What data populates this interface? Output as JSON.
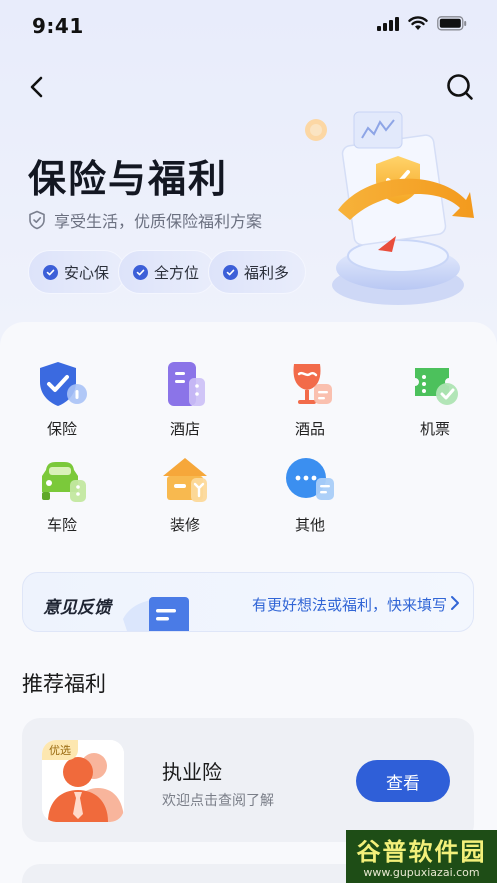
{
  "status_bar": {
    "time": "9:41"
  },
  "header": {
    "title": "保险与福利",
    "subtitle": "享受生活，优质保险福利方案",
    "tags": [
      "安心保",
      "全方位",
      "福利多"
    ]
  },
  "categories": [
    {
      "label": "保险",
      "icon": "shield-check-icon"
    },
    {
      "label": "酒店",
      "icon": "hotel-icon"
    },
    {
      "label": "酒品",
      "icon": "wine-icon"
    },
    {
      "label": "机票",
      "icon": "ticket-icon"
    },
    {
      "label": "车险",
      "icon": "car-icon"
    },
    {
      "label": "装修",
      "icon": "house-tools-icon"
    },
    {
      "label": "其他",
      "icon": "chat-more-icon"
    }
  ],
  "feedback": {
    "title": "意见反馈",
    "link": "有更好想法或福利，快来填写"
  },
  "recommend": {
    "section_title": "推荐福利",
    "items": [
      {
        "badge": "优选",
        "name": "执业险",
        "desc": "欢迎点击查阅了解",
        "button": "查看"
      }
    ]
  },
  "watermark": {
    "top": "谷普软件园",
    "bottom": "www.gupuxiazai.com"
  },
  "colors": {
    "accent": "#2f5fd8",
    "background": "#eef1fb"
  }
}
